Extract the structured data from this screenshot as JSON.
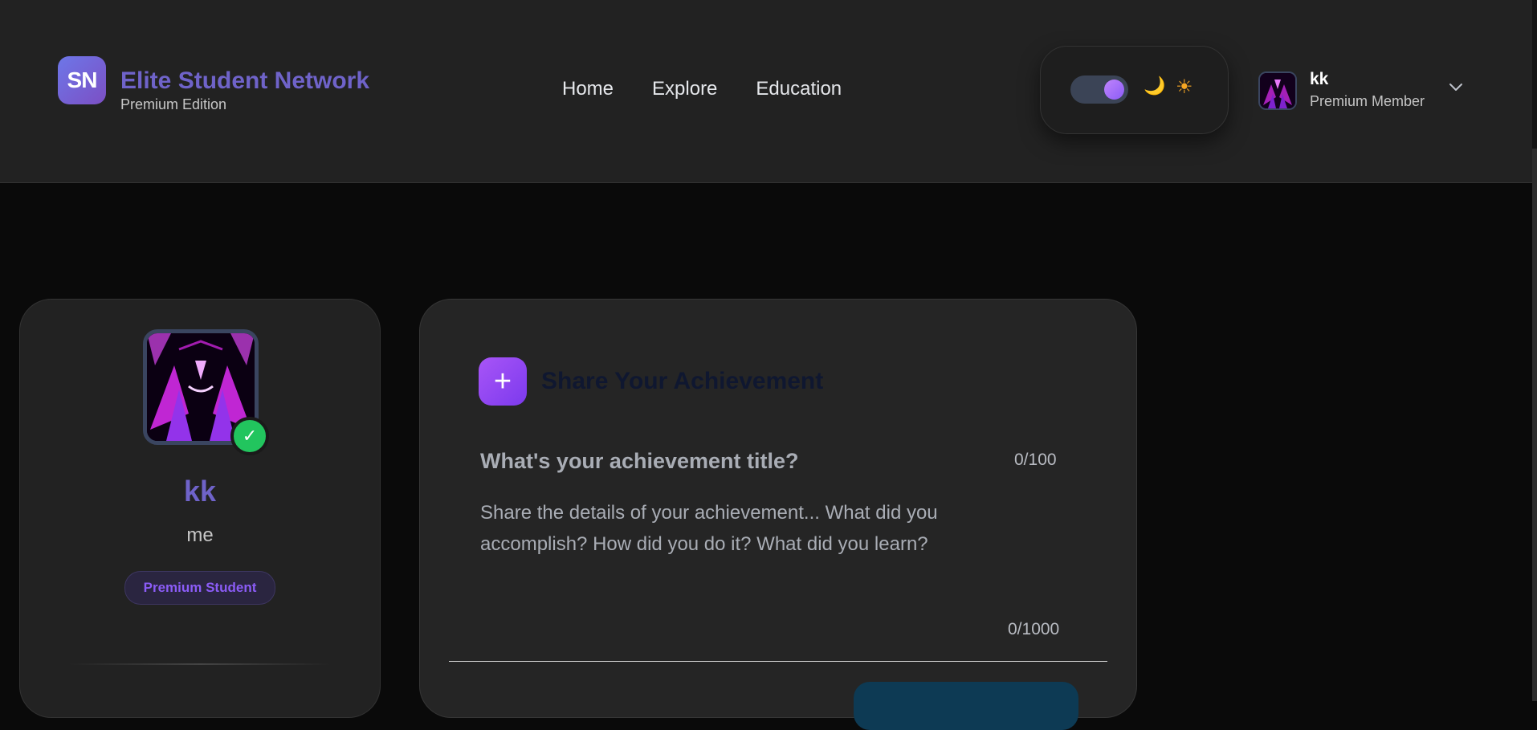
{
  "brand": {
    "logo_text": "SN",
    "title": "Elite Student Network",
    "subtitle": "Premium Edition"
  },
  "nav": {
    "items": [
      {
        "label": "Home"
      },
      {
        "label": "Explore"
      },
      {
        "label": "Education"
      }
    ]
  },
  "theme": {
    "mode": "dark",
    "moon_icon": "🌙",
    "sun_icon": "☀"
  },
  "user": {
    "name": "kk",
    "role": "Premium Member"
  },
  "profile": {
    "name": "kk",
    "bio": "me",
    "badge": "Premium Student",
    "verified_icon": "✓"
  },
  "achievement": {
    "add_icon": "+",
    "heading": "Share Your Achievement",
    "title_placeholder": "What's your achievement title?",
    "title_count": "0/100",
    "details_placeholder": "Share the details of your achievement... What did you accomplish? How did you do it? What did you learn?",
    "details_count": "0/1000"
  },
  "colors": {
    "accent": "#6f63c9",
    "accent_gradient_start": "#a855f7",
    "accent_gradient_end": "#7c3aed",
    "verified": "#22c55e"
  }
}
